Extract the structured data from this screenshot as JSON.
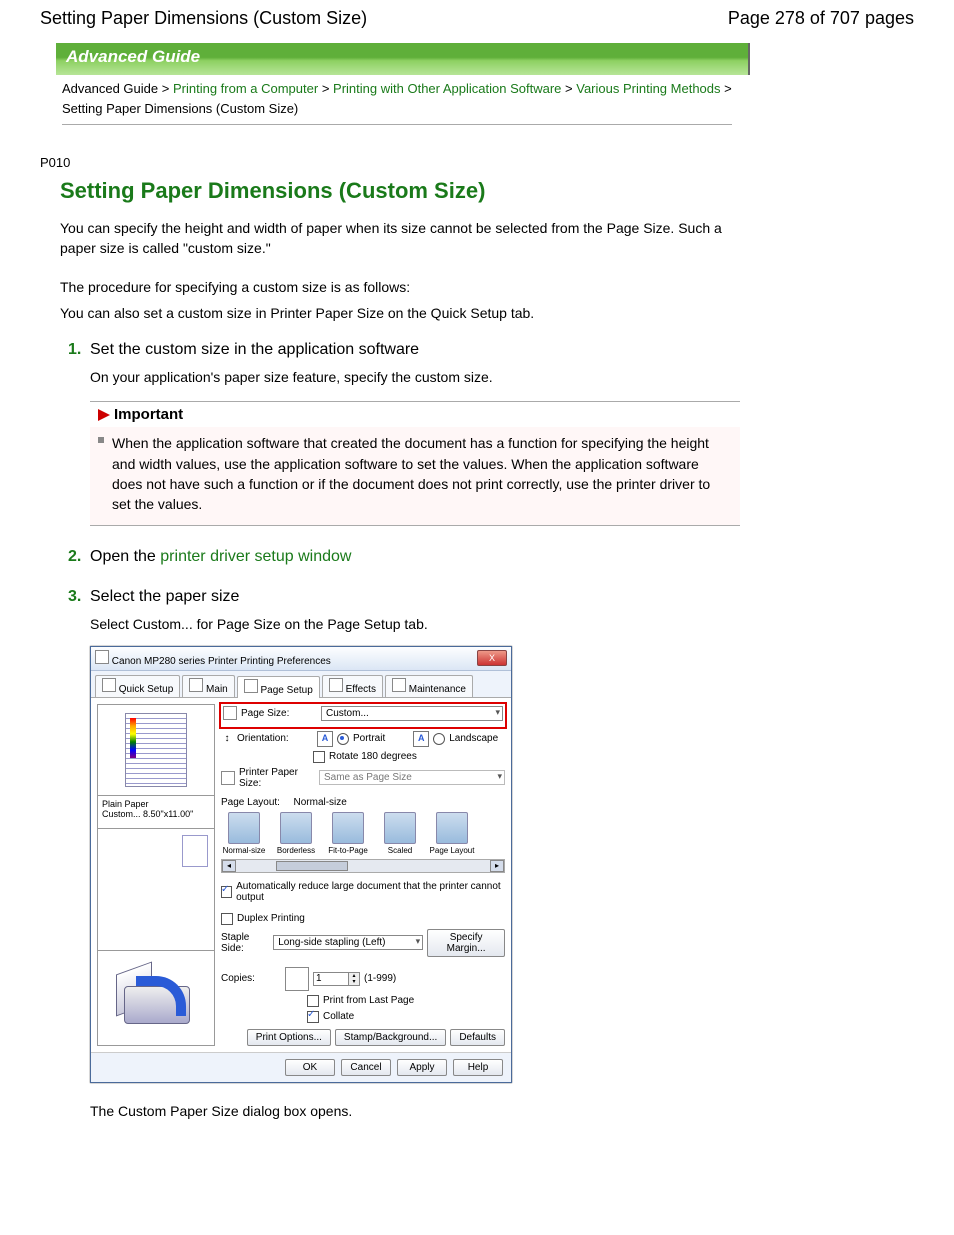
{
  "header": {
    "title": "Setting Paper Dimensions (Custom Size)",
    "page_info": "Page 278 of 707 pages"
  },
  "banner": {
    "text": "Advanced Guide"
  },
  "breadcrumb": {
    "items": [
      "Advanced Guide",
      "Printing from a Computer",
      "Printing with Other Application Software",
      "Various Printing Methods"
    ],
    "current": "Setting Paper Dimensions (Custom Size)",
    "sep": ">"
  },
  "article": {
    "code": "P010",
    "title": "Setting Paper Dimensions (Custom Size)",
    "intro1": "You can specify the height and width of paper when its size cannot be selected from the Page Size. Such a paper size is called \"custom size.\"",
    "intro2": "The procedure for specifying a custom size is as follows:",
    "intro3": "You can also set a custom size in Printer Paper Size on the Quick Setup tab.",
    "steps": {
      "s1": {
        "num": "1.",
        "title": "Set the custom size in the application software",
        "body": "On your application's paper size feature, specify the custom size.",
        "important_label": "Important",
        "important_body": "When the application software that created the document has a function for specifying the height and width values, use the application software to set the values. When the application software does not have such a function or if the document does not print correctly, use the printer driver to set the values."
      },
      "s2": {
        "num": "2.",
        "title_pre": "Open the ",
        "title_link": "printer driver setup window"
      },
      "s3": {
        "num": "3.",
        "title": "Select the paper size",
        "body": "Select Custom... for Page Size on the Page Setup tab.",
        "after": "The Custom Paper Size dialog box opens."
      }
    }
  },
  "dialog": {
    "title": "Canon MP280 series Printer Printing Preferences",
    "close_x": "X",
    "tabs": {
      "t1": "Quick Setup",
      "t2": "Main",
      "t3": "Page Setup",
      "t4": "Effects",
      "t5": "Maintenance"
    },
    "paper_info1": "Plain Paper",
    "paper_info2": "Custom... 8.50\"x11.00\"",
    "labels": {
      "page_size": "Page Size:",
      "orientation": "Orientation:",
      "portrait": "Portrait",
      "landscape": "Landscape",
      "rotate": "Rotate 180 degrees",
      "printer_paper_size": "Printer Paper Size:",
      "page_layout": "Page Layout:",
      "page_layout_value": "Normal-size",
      "auto_reduce": "Automatically reduce large document that the printer cannot output",
      "duplex": "Duplex Printing",
      "staple": "Staple Side:",
      "specify_margin": "Specify Margin...",
      "copies": "Copies:",
      "copies_range": "(1-999)",
      "from_last": "Print from Last Page",
      "collate": "Collate",
      "print_options": "Print Options...",
      "stamp_bg": "Stamp/Background...",
      "defaults": "Defaults"
    },
    "values": {
      "page_size": "Custom...",
      "printer_paper_size": "Same as Page Size",
      "staple": "Long-side stapling (Left)",
      "copies": "1"
    },
    "layouts": {
      "l1": "Normal-size",
      "l2": "Borderless",
      "l3": "Fit-to-Page",
      "l4": "Scaled",
      "l5": "Page Layout"
    },
    "footer": {
      "ok": "OK",
      "cancel": "Cancel",
      "apply": "Apply",
      "help": "Help"
    }
  }
}
